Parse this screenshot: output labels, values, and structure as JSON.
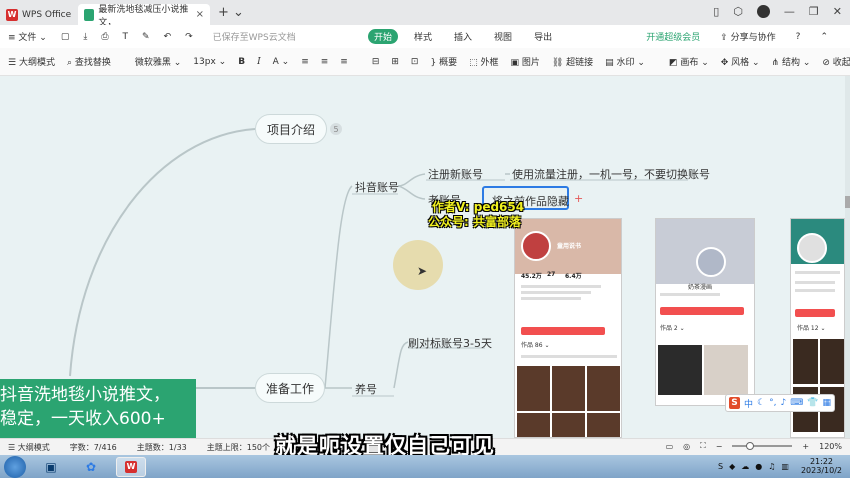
{
  "titlebar": {
    "app_tab": "WPS Office",
    "doc_tab": "最新洗地毯减压小说推文，",
    "tab_close": "×",
    "new_tab": "+ ⌄"
  },
  "menubar": {
    "file": "≡ 文件 ⌄",
    "saved_text": "已保存至WPS云文档",
    "tabs": [
      "开始",
      "样式",
      "插入",
      "视图",
      "导出"
    ],
    "vip": "开通超级会员",
    "share": "分享与协作",
    "help": "?",
    "more": "⌃"
  },
  "toolbar": {
    "outline_mode": "大纲模式",
    "find_replace": "查找替换",
    "font_name": "微软雅黑 ⌄",
    "font_size": "13px ⌄",
    "bold": "B",
    "italic": "I",
    "font_color": "A ⌄",
    "summary": "概要",
    "frame": "外框",
    "image": "图片",
    "hyperlink": "超链接",
    "watermark": "水印 ⌄",
    "canvas": "画布 ⌄",
    "style": "风格 ⌄",
    "structure": "结构 ⌄",
    "collapse": "收起 ⌄"
  },
  "mindmap": {
    "root_text_line1": "抖音洗地毯小说推文，",
    "root_text_line2": "稳定，一天收入600+",
    "node_intro": "项目介绍",
    "node_intro_badge": "5",
    "node_prepare": "准备工作",
    "node_douyin": "抖音账号",
    "node_register": "注册新账号",
    "node_register_desc": "使用流量注册，一机一号，不要切换账号",
    "node_old": "老账号",
    "node_old_selected": "将之前作品隐藏",
    "node_add": "+",
    "node_raise": "养号",
    "node_benchmark": "刷对标账号3-5天"
  },
  "overlay": {
    "author_line1": "作者V: ped654",
    "author_line2": "公众号: 共富部落"
  },
  "phones": {
    "p1_name": "童用说书",
    "p1_stats": [
      "45.2万",
      "27",
      "6.4万"
    ],
    "p1_works": "作品 86 ⌄",
    "p2_name": "奶茶漫画",
    "p2_works": "作品 2 ⌄",
    "p3_works": "作品 12 ⌄"
  },
  "ime": {
    "logo": "S",
    "lang": "中"
  },
  "statusbar": {
    "outline": "大纲模式",
    "word_count": "字数：7/416",
    "topic_count": "主题数：1/33",
    "topic_limit": "主题上限：150个",
    "zoom": "120%"
  },
  "caption": "就是呃设置仅自己可见",
  "taskbar": {
    "time": "21:22",
    "date": "2023/10/2"
  },
  "colors": {
    "accent": "#2ba471",
    "selection": "#2d7be4",
    "canvas": "#e9f2f3"
  }
}
